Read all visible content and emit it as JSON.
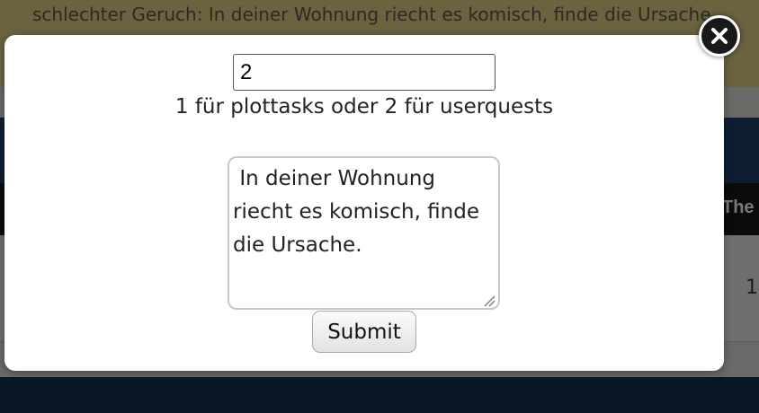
{
  "background": {
    "banner_text": "schlechter Geruch: In deiner Wohnung riecht es komisch, finde die Ursache.",
    "table_header_fragment": "The",
    "table_cell_fragment": "1"
  },
  "modal": {
    "type_input_value": "2",
    "hint": "1 für plottasks oder 2 für userquests",
    "description_value": " In deiner Wohnung riecht es komisch, finde die Ursache.",
    "submit_label": "Submit",
    "close_icon": "close-icon"
  }
}
